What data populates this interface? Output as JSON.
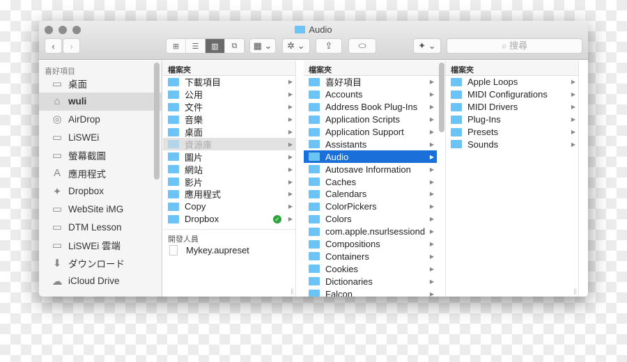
{
  "window": {
    "title": "Audio"
  },
  "toolbar": {
    "back": "‹",
    "forward": "›",
    "views": [
      "⊞",
      "☰",
      "▥",
      "⧉"
    ],
    "arrange": "▦ ⌄",
    "action": "✲ ⌄",
    "share": "⇪",
    "tag": "⬭",
    "dropbox": "✦ ⌄",
    "search_placeholder": "搜尋"
  },
  "sidebar": {
    "section": "喜好項目",
    "items": [
      {
        "label": "桌面",
        "icon": "desktop-icon",
        "glyph": "▭"
      },
      {
        "label": "wuli",
        "icon": "home-icon",
        "glyph": "⌂",
        "selected": true
      },
      {
        "label": "AirDrop",
        "icon": "airdrop-icon",
        "glyph": "◎"
      },
      {
        "label": "LiSWEi",
        "icon": "folder-icon",
        "glyph": "▭"
      },
      {
        "label": "螢幕截圖",
        "icon": "folder-icon",
        "glyph": "▭"
      },
      {
        "label": "應用程式",
        "icon": "applications-icon",
        "glyph": "A"
      },
      {
        "label": "Dropbox",
        "icon": "dropbox-icon",
        "glyph": "✦"
      },
      {
        "label": "WebSite iMG",
        "icon": "folder-icon",
        "glyph": "▭"
      },
      {
        "label": "DTM Lesson",
        "icon": "folder-icon",
        "glyph": "▭"
      },
      {
        "label": "LiSWEi 雲端",
        "icon": "folder-icon",
        "glyph": "▭"
      },
      {
        "label": "ダウンロード",
        "icon": "download-icon",
        "glyph": "⬇"
      },
      {
        "label": "iCloud Drive",
        "icon": "cloud-icon",
        "glyph": "☁"
      }
    ]
  },
  "columns": [
    {
      "header": "檔案夾",
      "items": [
        "下載項目",
        "公用",
        "文件",
        "音樂",
        "桌面",
        "資源庫",
        "圖片",
        "網站",
        "影片",
        "應用程式",
        "Copy",
        "Dropbox"
      ],
      "dimmed": "資源庫",
      "synced": "Dropbox",
      "section2": "開發人員",
      "files": [
        "Mykey.aupreset"
      ]
    },
    {
      "header": "檔案夾",
      "items": [
        "喜好項目",
        "Accounts",
        "Address Book Plug-Ins",
        "Application Scripts",
        "Application Support",
        "Assistants",
        "Audio",
        "Autosave Information",
        "Caches",
        "Calendars",
        "ColorPickers",
        "Colors",
        "com.apple.nsurlsessiond",
        "Compositions",
        "Containers",
        "Cookies",
        "Dictionaries",
        "Falcon"
      ],
      "selected": "Audio"
    },
    {
      "header": "檔案夾",
      "items": [
        "Apple Loops",
        "MIDI Configurations",
        "MIDI Drivers",
        "Plug-Ins",
        "Presets",
        "Sounds"
      ]
    }
  ],
  "colors": {
    "selection": "#1a6fd9",
    "folder": "#6cc3f5",
    "sync_check": "#2ba43a"
  }
}
